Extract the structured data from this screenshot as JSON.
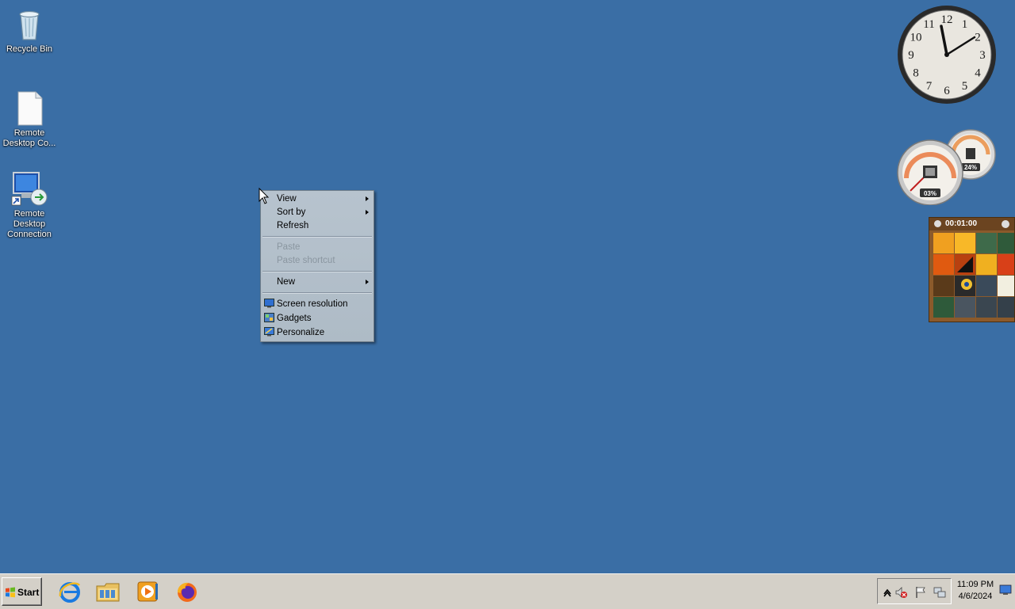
{
  "desktop": {
    "icons": [
      {
        "label": "Recycle Bin",
        "icon": "recycle-bin-icon"
      },
      {
        "label": "Remote Desktop Co...",
        "icon": "file-icon"
      },
      {
        "label": "Remote Desktop Connection",
        "icon": "remote-desktop-icon"
      }
    ]
  },
  "context_menu": {
    "items": [
      {
        "label": "View",
        "submenu": true,
        "enabled": true
      },
      {
        "label": "Sort by",
        "submenu": true,
        "enabled": true
      },
      {
        "label": "Refresh",
        "enabled": true
      },
      {
        "label": "Paste",
        "enabled": false
      },
      {
        "label": "Paste shortcut",
        "enabled": false
      },
      {
        "label": "New",
        "submenu": true,
        "enabled": true
      },
      {
        "label": "Screen resolution",
        "icon": "screen-resolution-icon",
        "enabled": true
      },
      {
        "label": "Gadgets",
        "icon": "gadgets-icon",
        "enabled": true
      },
      {
        "label": "Personalize",
        "icon": "personalize-icon",
        "enabled": true
      }
    ]
  },
  "gadgets": {
    "clock": {
      "numbers": [
        "12",
        "1",
        "2",
        "3",
        "4",
        "5",
        "6",
        "7",
        "8",
        "9",
        "10",
        "11"
      ],
      "time_shown": "11:09"
    },
    "cpu_meter": {
      "cpu": "03%",
      "memory": "24%"
    },
    "puzzle": {
      "timer": "00:01:00"
    }
  },
  "taskbar": {
    "start_label": "Start",
    "apps": [
      "internet-explorer-icon",
      "file-explorer-icon",
      "media-player-icon",
      "firefox-icon"
    ],
    "tray_icons": [
      "show-hidden-icons-icon",
      "volume-muted-icon",
      "action-center-flag-icon",
      "network-icon"
    ],
    "clock_time": "11:09 PM",
    "clock_date": "4/6/2024"
  },
  "colors": {
    "desktop_bg": "#3a6ea5",
    "taskbar_bg": "#d4d0c8",
    "menu_bg": "#b3bfca"
  }
}
